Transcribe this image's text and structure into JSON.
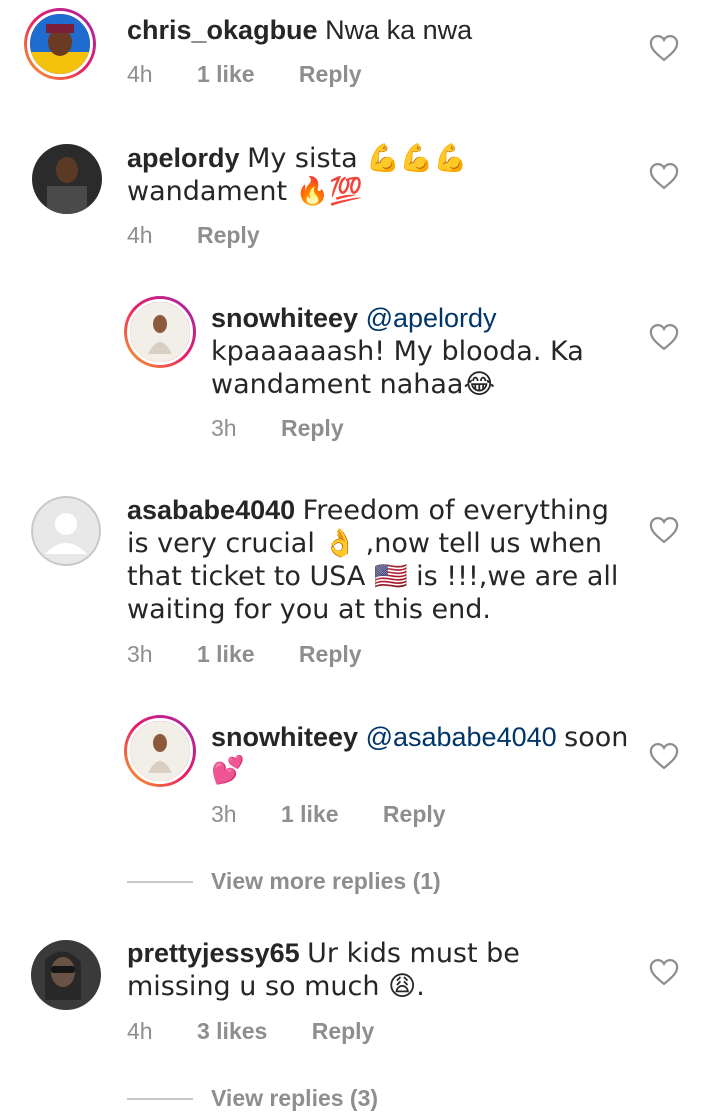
{
  "comments": [
    {
      "username": "chris_okagbue",
      "text": "Nwa ka nwa",
      "time": "4h",
      "likes": "1 like",
      "reply": "Reply"
    },
    {
      "username": "apelordy",
      "text": "My sista 💪💪💪 wandament 🔥💯",
      "time": "4h",
      "reply": "Reply"
    },
    {
      "username": "snowhiteey",
      "mention": "@apelordy",
      "text": "kpaaaaaash! My blooda. Ka wandament nahaa😂",
      "time": "3h",
      "reply": "Reply"
    },
    {
      "username": "asababe4040",
      "text": "Freedom of everything is very crucial 👌 ,now tell us when that ticket to USA 🇺🇸 is !!!,we are all waiting for you at this end.",
      "time": "3h",
      "likes": "1 like",
      "reply": "Reply"
    },
    {
      "username": "snowhiteey",
      "mention": "@asababe4040",
      "text": "soon 💕",
      "time": "3h",
      "likes": "1 like",
      "reply": "Reply"
    },
    {
      "username": "prettyjessy65",
      "text": "Ur kids must be missing u so much 😩.",
      "time": "4h",
      "likes": "3 likes",
      "reply": "Reply"
    }
  ],
  "view_more_replies": "View more replies (1)",
  "view_replies": "View replies (3)",
  "colors": {
    "meta": "#8e8e8e",
    "mention": "#003569",
    "text": "#262626"
  }
}
